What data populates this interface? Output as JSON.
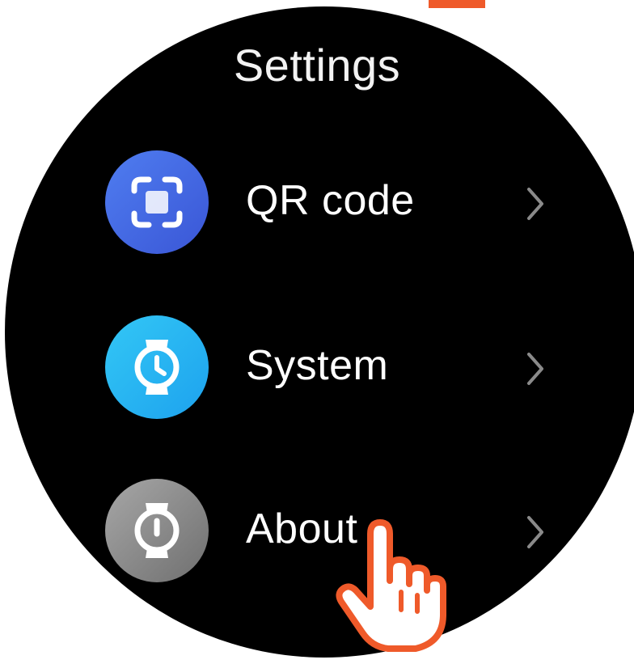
{
  "screen": {
    "title": "Settings",
    "accent_color": "#ef5a2a",
    "background_color": "#000000"
  },
  "menu": {
    "items": [
      {
        "label": "QR code",
        "icon": "qr-scan-icon",
        "icon_color": "#4169e1"
      },
      {
        "label": "System",
        "icon": "watch-clock-icon",
        "icon_color": "#22b0f0"
      },
      {
        "label": "About",
        "icon": "watch-info-icon",
        "icon_color": "#8c8c8c"
      }
    ],
    "chevron_icon": "chevron-right-icon"
  },
  "overlay": {
    "pointer_icon": "tap-hand-cursor-icon",
    "pointer_color": "#ef5a2a"
  }
}
